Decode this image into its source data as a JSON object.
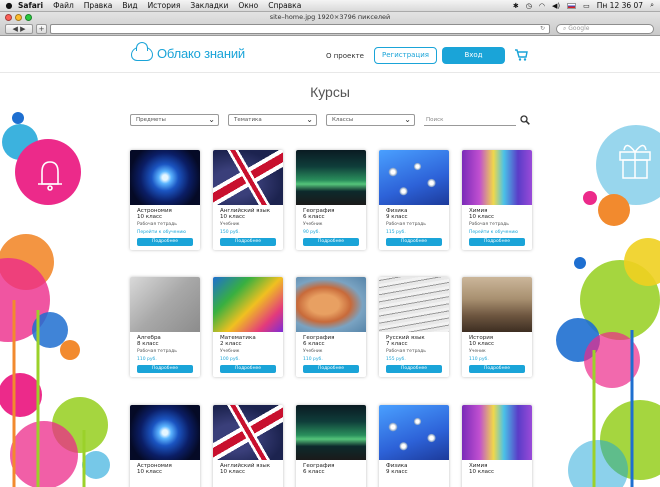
{
  "menubar": {
    "app": "Safari",
    "items": [
      "Файл",
      "Правка",
      "Вид",
      "История",
      "Закладки",
      "Окно",
      "Справка"
    ],
    "clock": "Пн 12 36 07"
  },
  "browser": {
    "window_title": "site–home.jpg 1920×3796 пикселей",
    "back_forward": "◀ ▶",
    "add_button": "+",
    "search_placeholder": "Google",
    "reload": "↻"
  },
  "site": {
    "logo_text": "Облако знаний",
    "nav_about": "О проекте",
    "register_label": "Регистрация",
    "login_label": "Вход"
  },
  "main": {
    "title": "Курсы",
    "filters": [
      {
        "label": "Предметы"
      },
      {
        "label": "Тематика"
      },
      {
        "label": "Классы"
      }
    ],
    "search_placeholder": "Поиск",
    "details_label": "Подробнее"
  },
  "cards": [
    {
      "title": "Астрономия",
      "grade": "10 класс",
      "type": "Рабочая тетрадь",
      "price": "Перейти к обучению"
    },
    {
      "title": "Английский язык",
      "grade": "10 класс",
      "type": "Учебник",
      "price": "150 руб."
    },
    {
      "title": "География",
      "grade": "6 класс",
      "type": "Учебник",
      "price": "90 руб."
    },
    {
      "title": "Физика",
      "grade": "9 класс",
      "type": "Рабочая тетрадь",
      "price": "115 руб."
    },
    {
      "title": "Химия",
      "grade": "10 класс",
      "type": "Рабочая тетрадь",
      "price": "Перейти к обучению"
    },
    {
      "title": "Алгебра",
      "grade": "8 класс",
      "type": "Рабочая тетрадь",
      "price": "110 руб."
    },
    {
      "title": "Математика",
      "grade": "2 класс",
      "type": "Учебник",
      "price": "100 руб."
    },
    {
      "title": "География",
      "grade": "6 класс",
      "type": "Учебник",
      "price": "110 руб."
    },
    {
      "title": "Русский язык",
      "grade": "7 класс",
      "type": "Рабочая тетрадь",
      "price": "155 руб."
    },
    {
      "title": "История",
      "grade": "10 класс",
      "type": "Ученик",
      "price": "110 руб."
    },
    {
      "title": "Астрономия",
      "grade": "10 класс"
    },
    {
      "title": "Английский язык",
      "grade": "10 класс"
    },
    {
      "title": "География",
      "grade": "6 класс"
    },
    {
      "title": "Физика",
      "grade": "9 класс"
    },
    {
      "title": "Химия",
      "grade": "10 класс"
    }
  ],
  "colors": {
    "accent": "#1aa4d8",
    "pink": "#ec2a8a",
    "orange": "#f28a2e",
    "green": "#9bd12a",
    "blue": "#1e6fd0"
  }
}
